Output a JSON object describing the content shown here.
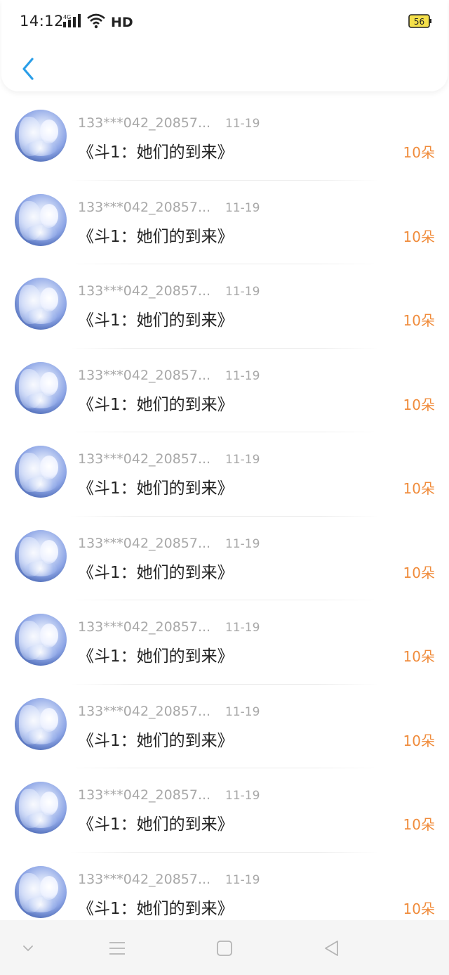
{
  "status_bar": {
    "time": "14:12",
    "network": "4G",
    "hd_label": "HD",
    "battery": "56"
  },
  "header": {
    "back_icon": "chevron-left-icon",
    "accent_color": "#2a9ee8"
  },
  "records": [
    {
      "user": "133***042_20857...",
      "date": "11-19",
      "title": "《斗1：她们的到来》",
      "amount": "10朵"
    },
    {
      "user": "133***042_20857...",
      "date": "11-19",
      "title": "《斗1：她们的到来》",
      "amount": "10朵"
    },
    {
      "user": "133***042_20857...",
      "date": "11-19",
      "title": "《斗1：她们的到来》",
      "amount": "10朵"
    },
    {
      "user": "133***042_20857...",
      "date": "11-19",
      "title": "《斗1：她们的到来》",
      "amount": "10朵"
    },
    {
      "user": "133***042_20857...",
      "date": "11-19",
      "title": "《斗1：她们的到来》",
      "amount": "10朵"
    },
    {
      "user": "133***042_20857...",
      "date": "11-19",
      "title": "《斗1：她们的到来》",
      "amount": "10朵"
    },
    {
      "user": "133***042_20857...",
      "date": "11-19",
      "title": "《斗1：她们的到来》",
      "amount": "10朵"
    },
    {
      "user": "133***042_20857...",
      "date": "11-19",
      "title": "《斗1：她们的到来》",
      "amount": "10朵"
    },
    {
      "user": "133***042_20857...",
      "date": "11-19",
      "title": "《斗1：她们的到来》",
      "amount": "10朵"
    },
    {
      "user": "133***042_20857...",
      "date": "11-19",
      "title": "《斗1：她们的到来》",
      "amount": "10朵"
    }
  ],
  "colors": {
    "amount": "#f08c3c",
    "name": "#a8a8a8",
    "title": "#222222"
  },
  "nav_bar": {
    "icons": [
      "chevron-down-icon",
      "menu-icon",
      "home-square-icon",
      "back-triangle-icon"
    ]
  }
}
